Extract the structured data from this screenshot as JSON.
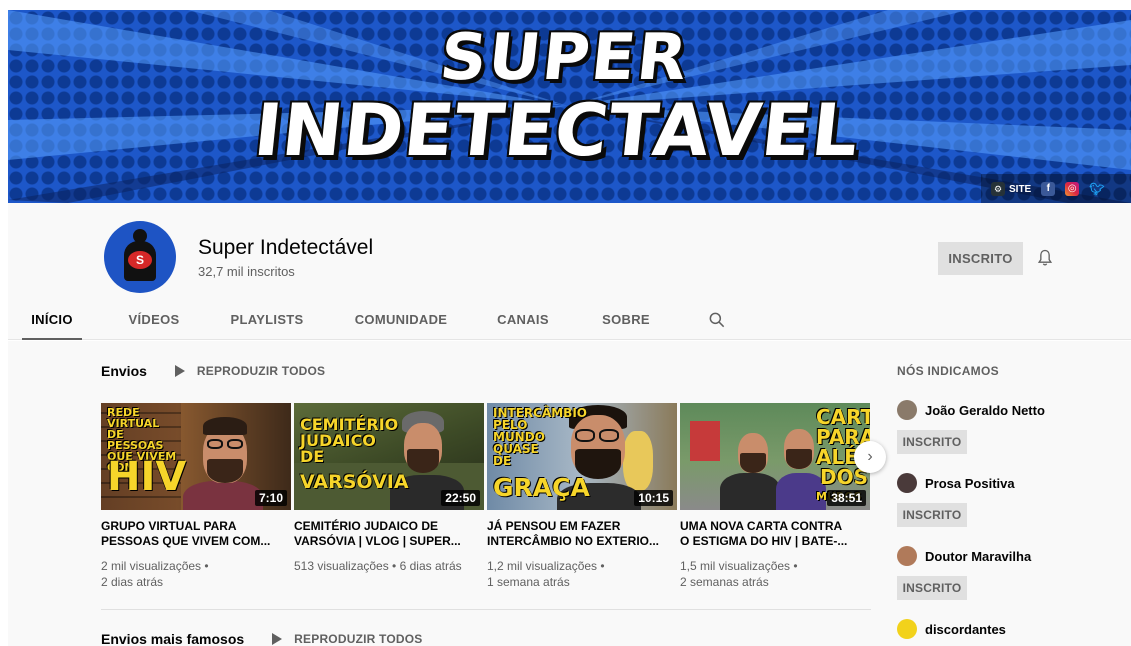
{
  "banner": {
    "title_line1": "SUPER",
    "title_line2": "INDETECTAVEL",
    "site_label": "SITE",
    "social": [
      "f",
      "◎",
      "t"
    ]
  },
  "channel": {
    "name": "Super Indetectável",
    "subscribers": "32,7 mil inscritos",
    "subscribe_label": "INSCRITO"
  },
  "tabs": [
    {
      "label": "INÍCIO",
      "active": true
    },
    {
      "label": "VÍDEOS"
    },
    {
      "label": "PLAYLISTS"
    },
    {
      "label": "COMUNIDADE"
    },
    {
      "label": "CANAIS"
    },
    {
      "label": "SOBRE"
    }
  ],
  "uploads": {
    "title": "Envios",
    "play_all": "REPRODUZIR TODOS",
    "videos": [
      {
        "title_line1": "GRUPO VIRTUAL PARA",
        "title_line2": "PESSOAS QUE VIVEM COM...",
        "meta_line1": "2 mil visualizações •",
        "meta_line2": "2 dias atrás",
        "duration": "7:10",
        "thumb_text": "REDE VIRTUAL DE PESSOAS QUE VIVEM COM",
        "thumb_big": "HIV"
      },
      {
        "title_line1": "CEMITÉRIO JUDAICO DE",
        "title_line2": "VARSÓVIA | VLOG | SUPER...",
        "meta_line1": "513 visualizações • 6 dias atrás",
        "meta_line2": "",
        "duration": "22:50",
        "thumb_text": "CEMITÉRIO JUDAICO DE",
        "thumb_big": "VARSÓVIA"
      },
      {
        "title_line1": "JÁ PENSOU EM FAZER",
        "title_line2": "INTERCÂMBIO NO EXTERIO...",
        "meta_line1": "1,2 mil visualizações •",
        "meta_line2": "1 semana atrás",
        "duration": "10:15",
        "thumb_text": "INTERCÂMBIO PELO MUNDO QUASE DE",
        "thumb_big": "GRAÇA"
      },
      {
        "title_line1": "UMA NOVA CARTA CONTRA",
        "title_line2": "O ESTIGMA DO HIV | BATE-...",
        "meta_line1": "1,5 mil visualizações •",
        "meta_line2": "2 semanas atrás",
        "duration": "38:51",
        "thumb_text": "CARTA PARA ALÉM DOS",
        "thumb_big": "MUROS"
      }
    ]
  },
  "popular": {
    "title": "Envios mais famosos",
    "play_all": "REPRODUZIR TODOS"
  },
  "sidebar": {
    "title": "NÓS INDICAMOS",
    "channels": [
      {
        "name": "João Geraldo Netto",
        "button": "INSCRITO"
      },
      {
        "name": "Prosa Positiva",
        "button": "INSCRITO"
      },
      {
        "name": "Doutor Maravilha",
        "button": "INSCRITO"
      },
      {
        "name": "discordantes",
        "button": ""
      }
    ]
  },
  "colors": {
    "banner_blue": "#1d57c9",
    "thumb_yellow": "#f6d52a",
    "muted_text": "#606060"
  }
}
